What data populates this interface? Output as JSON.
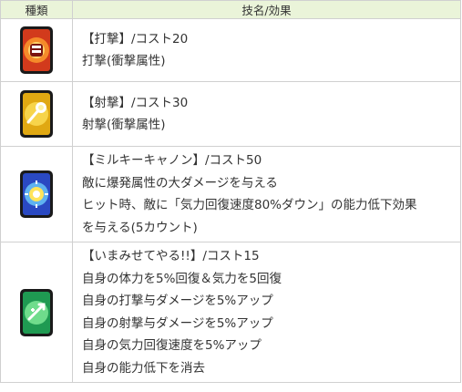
{
  "header": {
    "type_col": "種類",
    "skill_col": "技名/効果"
  },
  "rows": [
    {
      "icon": "red-fist-skill-card-icon",
      "lines": [
        "【打撃】/コスト20",
        "打撃(衝撃属性)"
      ]
    },
    {
      "icon": "yellow-ki-blast-skill-card-icon",
      "lines": [
        "【射撃】/コスト30",
        "射撃(衝撃属性)"
      ]
    },
    {
      "icon": "blue-milky-cannon-skill-card-icon",
      "lines": [
        "【ミルキーキャノン】/コスト50",
        "敵に爆発属性の大ダメージを与える",
        "ヒット時、敵に「気力回復速度80%ダウン」の能力低下効果",
        "を与える(5カウント)"
      ]
    },
    {
      "icon": "green-buff-skill-card-icon",
      "lines": [
        "【いまみせてやる!!】/コスト15",
        "自身の体力を5%回復＆気力を5回復",
        "自身の打撃与ダメージを5%アップ",
        "自身の射撃与ダメージを5%アップ",
        "自身の気力回復速度を5%アップ",
        "自身の能力低下を消去"
      ]
    }
  ]
}
